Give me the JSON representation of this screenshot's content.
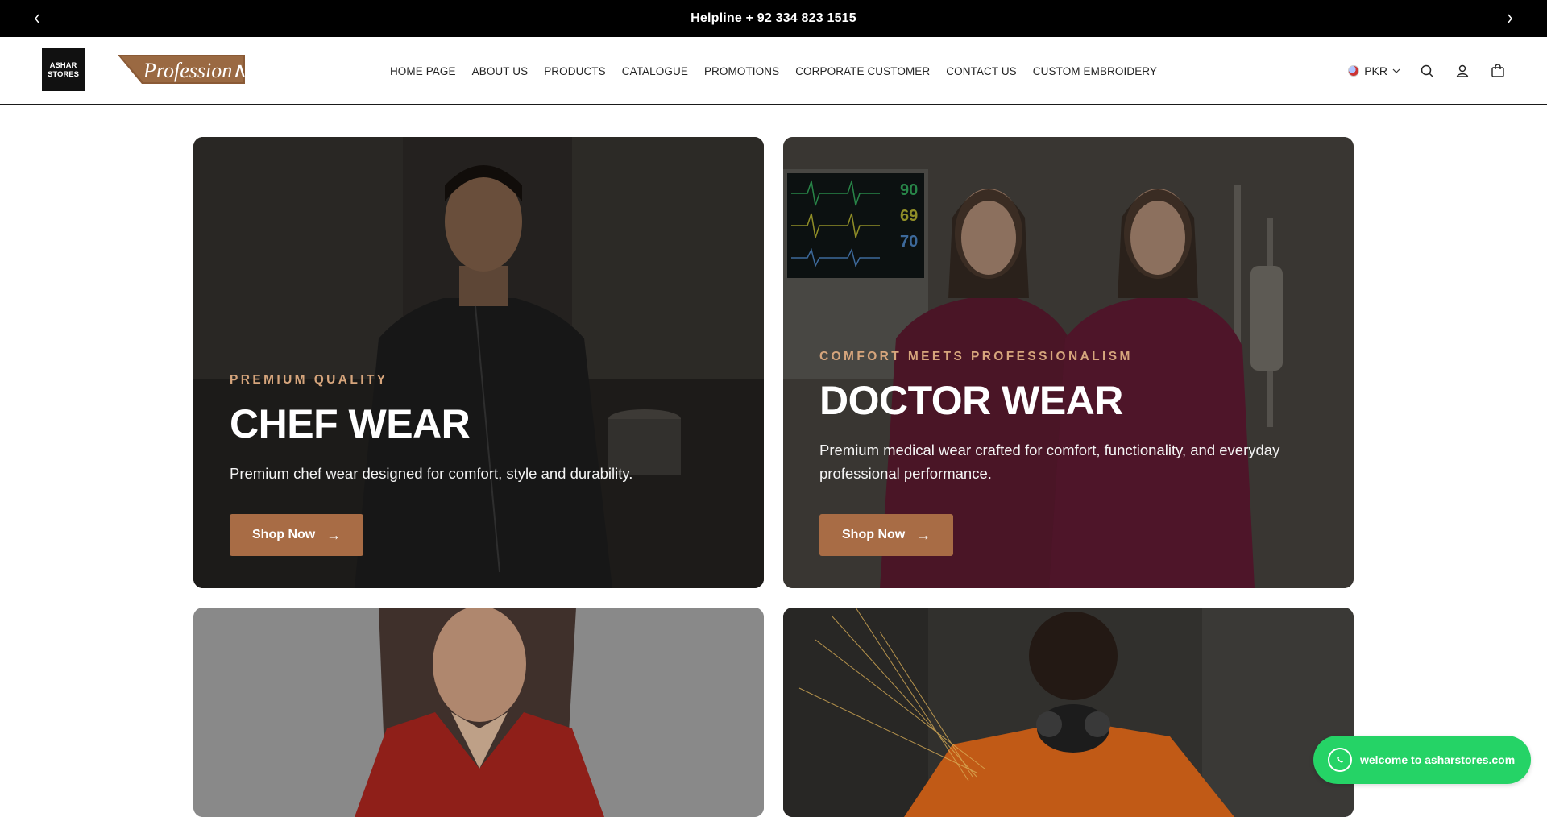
{
  "announcement": {
    "text": "Helpline + 92 334 823 1515",
    "prev_icon": "chevron-left-icon",
    "next_icon": "chevron-right-icon"
  },
  "header": {
    "logo_line1": "ASHAR",
    "logo_line2": "STORES",
    "brand_text": "Profession∧l",
    "nav": [
      {
        "label": "HOME PAGE"
      },
      {
        "label": "ABOUT US"
      },
      {
        "label": "PRODUCTS"
      },
      {
        "label": "CATALOGUE"
      },
      {
        "label": "PROMOTIONS"
      },
      {
        "label": "CORPORATE CUSTOMER"
      },
      {
        "label": "CONTACT US"
      },
      {
        "label": "CUSTOM EMBROIDERY"
      }
    ],
    "currency": "PKR",
    "icons": [
      "search-icon",
      "account-icon",
      "cart-icon"
    ]
  },
  "cards": [
    {
      "eyebrow": "PREMIUM QUALITY",
      "title": "CHEF WEAR",
      "description": "Premium chef wear designed for comfort, style and durability.",
      "button": "Shop Now",
      "button_arrow": "→"
    },
    {
      "eyebrow": "COMFORT MEETS PROFESSIONALISM",
      "title": "DOCTOR WEAR",
      "description": "Premium medical wear crafted for comfort, functionality, and everyday professional performance.",
      "button": "Shop Now",
      "button_arrow": "→"
    }
  ],
  "monitor_readings": [
    "90",
    "69",
    "70"
  ],
  "whatsapp": {
    "label": "welcome to asharstores.com"
  },
  "colors": {
    "accent": "#a86c45",
    "eyebrow": "#d6a57c",
    "whatsapp": "#25d366"
  }
}
